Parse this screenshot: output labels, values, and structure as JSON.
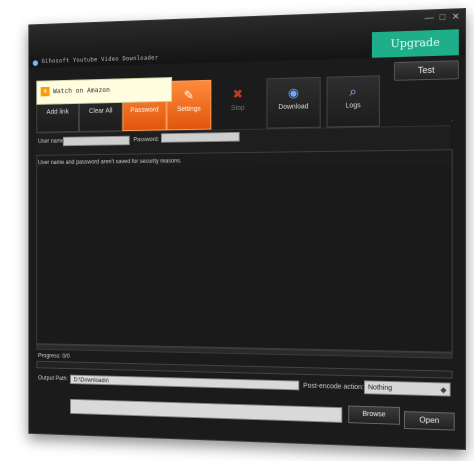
{
  "window": {
    "title": "Gihosoft Youtube Video Downloader",
    "controls": [
      "—",
      "□",
      "✕"
    ]
  },
  "header": {
    "upgrade_label": "Upgrade",
    "test_label": "Test",
    "amazon_text": "Watch on Amazon",
    "amazon_logo": "a"
  },
  "toolbar": {
    "items": [
      {
        "label": "Add link",
        "icon": "plus-icon",
        "glyph": "✚",
        "state": "normal"
      },
      {
        "label": "Clear All",
        "icon": "clear-icon",
        "glyph": "▮",
        "state": "normal"
      },
      {
        "label": "Password",
        "icon": "key-icon",
        "glyph": "⚿",
        "state": "active"
      },
      {
        "label": "Settings",
        "icon": "wrench-icon",
        "glyph": "✎",
        "state": "active"
      },
      {
        "label": "Stop",
        "icon": "stop-icon",
        "glyph": "✖",
        "state": "disabled"
      },
      {
        "label": "Download",
        "icon": "globe-icon",
        "glyph": "◉",
        "state": "normal"
      },
      {
        "label": "Logs",
        "icon": "logs-icon",
        "glyph": "⌕",
        "state": "normal"
      }
    ]
  },
  "credentials": {
    "username_label": "User name:",
    "username_value": "",
    "password_label": "Password:",
    "password_value": "",
    "notice": "User name and password aren't saved for security reasons."
  },
  "progress": {
    "label": "Progress: 0/0",
    "fraction": 0
  },
  "output": {
    "label": "Output Path:",
    "value": "D:\\Downloads\\",
    "post_encode_label": "Post-encode action:",
    "post_encode_value": "Nothing",
    "browse_label": "Browse",
    "open_label": "Open"
  },
  "colors": {
    "accent": "#1fae8a",
    "active_button": "#ff7a2a"
  }
}
